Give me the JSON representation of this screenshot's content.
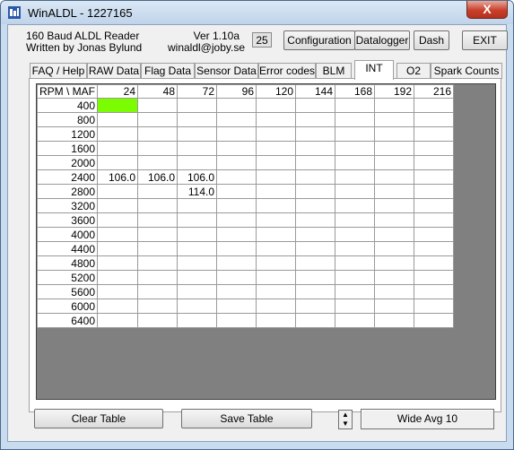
{
  "window": {
    "title": "WinALDL - 1227165",
    "close_label": "X"
  },
  "header": {
    "app_name": "160 Baud ALDL Reader",
    "author": "Written by Jonas Bylund",
    "version": "Ver 1.10a",
    "email": "winaldl@joby.se",
    "counter": "25",
    "buttons": {
      "configuration": "Configuration",
      "datalogger": "Datalogger",
      "dash": "Dash",
      "exit": "EXIT"
    }
  },
  "tabs": [
    "FAQ / Help",
    "RAW Data",
    "Flag Data",
    "Sensor Data",
    "Error codes",
    "BLM",
    "INT",
    "O2",
    "Spark Counts"
  ],
  "active_tab": "INT",
  "table": {
    "corner": "RPM \\ MAF",
    "columns": [
      "24",
      "48",
      "72",
      "96",
      "120",
      "144",
      "168",
      "192",
      "216"
    ],
    "rows": [
      {
        "rpm": "400",
        "cells": [
          "",
          "",
          "",
          "",
          "",
          "",
          "",
          "",
          ""
        ]
      },
      {
        "rpm": "800",
        "cells": [
          "",
          "",
          "",
          "",
          "",
          "",
          "",
          "",
          ""
        ]
      },
      {
        "rpm": "1200",
        "cells": [
          "",
          "",
          "",
          "",
          "",
          "",
          "",
          "",
          ""
        ]
      },
      {
        "rpm": "1600",
        "cells": [
          "",
          "",
          "",
          "",
          "",
          "",
          "",
          "",
          ""
        ]
      },
      {
        "rpm": "2000",
        "cells": [
          "",
          "",
          "",
          "",
          "",
          "",
          "",
          "",
          ""
        ]
      },
      {
        "rpm": "2400",
        "cells": [
          "106.0",
          "106.0",
          "106.0",
          "",
          "",
          "",
          "",
          "",
          ""
        ]
      },
      {
        "rpm": "2800",
        "cells": [
          "",
          "",
          "114.0",
          "",
          "",
          "",
          "",
          "",
          ""
        ]
      },
      {
        "rpm": "3200",
        "cells": [
          "",
          "",
          "",
          "",
          "",
          "",
          "",
          "",
          ""
        ]
      },
      {
        "rpm": "3600",
        "cells": [
          "",
          "",
          "",
          "",
          "",
          "",
          "",
          "",
          ""
        ]
      },
      {
        "rpm": "4000",
        "cells": [
          "",
          "",
          "",
          "",
          "",
          "",
          "",
          "",
          ""
        ]
      },
      {
        "rpm": "4400",
        "cells": [
          "",
          "",
          "",
          "",
          "",
          "",
          "",
          "",
          ""
        ]
      },
      {
        "rpm": "4800",
        "cells": [
          "",
          "",
          "",
          "",
          "",
          "",
          "",
          "",
          ""
        ]
      },
      {
        "rpm": "5200",
        "cells": [
          "",
          "",
          "",
          "",
          "",
          "",
          "",
          "",
          ""
        ]
      },
      {
        "rpm": "5600",
        "cells": [
          "",
          "",
          "",
          "",
          "",
          "",
          "",
          "",
          ""
        ]
      },
      {
        "rpm": "6000",
        "cells": [
          "",
          "",
          "",
          "",
          "",
          "",
          "",
          "",
          ""
        ]
      },
      {
        "rpm": "6400",
        "cells": [
          "",
          "",
          "",
          "",
          "",
          "",
          "",
          "",
          ""
        ]
      }
    ],
    "highlight": {
      "row_rpm": "400",
      "column": "24",
      "color": "#7cfc00"
    }
  },
  "footer": {
    "clear_table": "Clear Table",
    "save_table": "Save Table",
    "avg_mode": "Wide Avg 10"
  },
  "colors": {
    "title_bar": "#bfd3ea",
    "close_button": "#c8402c",
    "grid_background": "#808080",
    "highlight": "#7cfc00"
  }
}
